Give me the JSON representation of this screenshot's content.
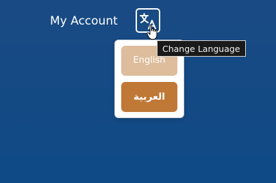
{
  "header": {
    "account_label": "My Account",
    "language_button_icon": "translate-icon"
  },
  "tooltip": {
    "text": "Change Language"
  },
  "language_menu": {
    "options": [
      {
        "label": "English",
        "selected": false,
        "color": "#ddbd9c"
      },
      {
        "label": "العربية",
        "selected": true,
        "color": "#c07836"
      }
    ]
  },
  "colors": {
    "background": "#154a84",
    "accent": "#c07836"
  }
}
